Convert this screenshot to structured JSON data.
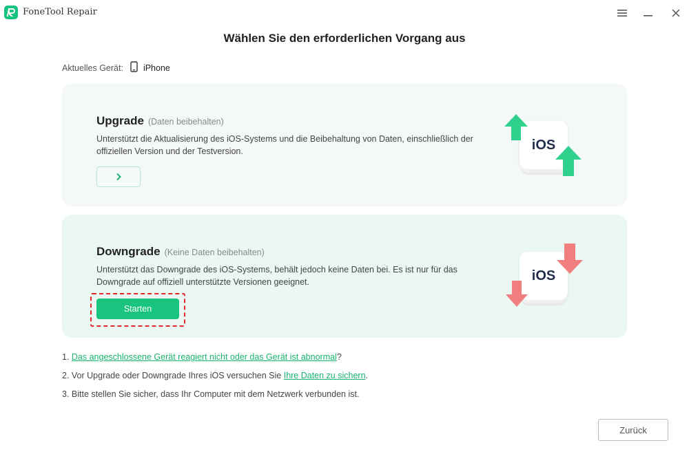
{
  "app": {
    "title": "FoneTool Repair",
    "accent_color": "#18c47e",
    "icons": [
      "menu-icon",
      "minimize-icon",
      "close-icon"
    ]
  },
  "main": {
    "heading": "Wählen Sie den erforderlichen Vorgang aus",
    "device_label": "Aktuelles Gerät:",
    "device_name": "iPhone"
  },
  "upgrade": {
    "title": "Upgrade",
    "subtitle": "(Daten beibehalten)",
    "description": "Unterstützt die Aktualisierung des iOS-Systems und die Beibehaltung von Daten, einschließlich der offiziellen Version und der Testversion.",
    "graphic_label": "iOS",
    "arrow_color": "#2fd18c"
  },
  "downgrade": {
    "title": "Downgrade",
    "subtitle": "(Keine Daten beibehalten)",
    "description": "Unterstützt das Downgrade des iOS-Systems, behält jedoch keine Daten bei. Es ist nur für das Downgrade auf offiziell unterstützte Versionen geeignet.",
    "start_label": "Starten",
    "graphic_label": "iOS",
    "arrow_color": "#f27f7f"
  },
  "notes": {
    "n1_prefix": "1. ",
    "n1_link": "Das angeschlossene Gerät reagiert nicht oder das Gerät ist abnormal",
    "n1_suffix": "?",
    "n2_prefix": "2. Vor Upgrade oder Downgrade Ihres iOS versuchen Sie ",
    "n2_link": "Ihre Daten zu sichern",
    "n2_suffix": ".",
    "n3": "3. Bitte stellen Sie sicher, dass Ihr Computer mit dem Netzwerk verbunden ist."
  },
  "footer": {
    "back_label": "Zurück"
  }
}
